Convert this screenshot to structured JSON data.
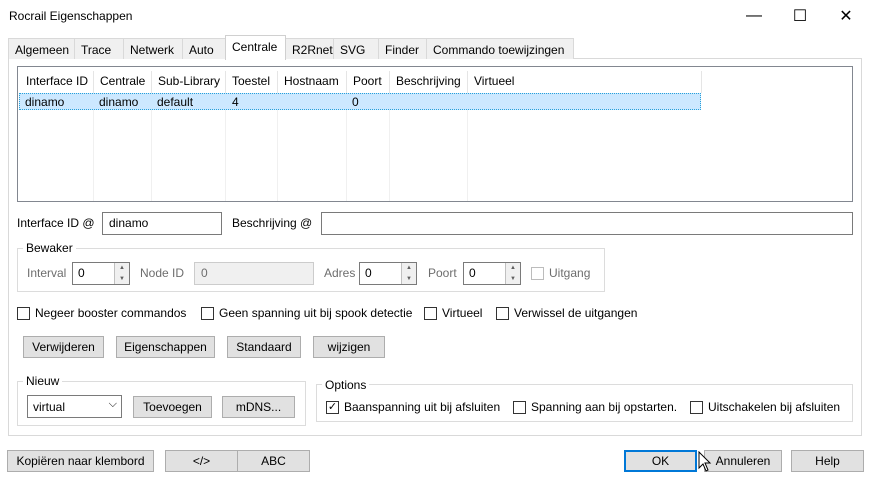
{
  "window": {
    "title": "Rocrail Eigenschappen",
    "minimize_glyph": "—",
    "maximize_glyph": "☐",
    "close_glyph": "✕"
  },
  "tabs": [
    {
      "label": "Algemeen"
    },
    {
      "label": "Trace"
    },
    {
      "label": "Netwerk"
    },
    {
      "label": "Auto"
    },
    {
      "label": "Centrale"
    },
    {
      "label": "R2Rnet"
    },
    {
      "label": "SVG"
    },
    {
      "label": "Finder"
    },
    {
      "label": "Commando toewijzingen"
    }
  ],
  "active_tab": "Centrale",
  "table": {
    "columns": [
      "Interface ID",
      "Centrale",
      "Sub-Library",
      "Toestel",
      "Hostnaam",
      "Poort",
      "Beschrijving",
      "Virtueel"
    ],
    "rows": [
      [
        "dinamo",
        "dinamo",
        "default",
        "4",
        "",
        "0",
        "",
        ""
      ]
    ]
  },
  "form": {
    "interface_id_label": "Interface ID @",
    "interface_id_value": "dinamo",
    "beschrijving_label": "Beschrijving @",
    "beschrijving_value": ""
  },
  "bewaker": {
    "title": "Bewaker",
    "interval_label": "Interval",
    "interval_value": "0",
    "nodeid_label": "Node ID",
    "nodeid_value": "0",
    "adres_label": "Adres",
    "adres_value": "0",
    "poort_label": "Poort",
    "poort_value": "0",
    "uitgang_label": "Uitgang",
    "uitgang_checked": false
  },
  "options_row": [
    {
      "label": "Negeer booster commandos",
      "checked": false
    },
    {
      "label": "Geen spanning uit bij spook detectie",
      "checked": false
    },
    {
      "label": "Virtueel",
      "checked": false
    },
    {
      "label": "Verwissel de uitgangen",
      "checked": false
    }
  ],
  "action_buttons": {
    "delete": "Verwijderen",
    "properties": "Eigenschappen",
    "default": "Standaard",
    "modify": "wijzigen"
  },
  "nieuw": {
    "title": "Nieuw",
    "selected": "virtual",
    "add_button": "Toevoegen",
    "mdns_button": "mDNS..."
  },
  "options": {
    "title": "Options",
    "items": [
      {
        "label": "Baanspanning uit bij afsluiten",
        "checked": true
      },
      {
        "label": "Spanning aan bij opstarten.",
        "checked": false
      },
      {
        "label": "Uitschakelen bij afsluiten",
        "checked": false
      }
    ]
  },
  "footer": {
    "copy": "Kopiëren naar klembord",
    "xml": "</>",
    "abc": "ABC",
    "ok": "OK",
    "cancel": "Annuleren",
    "help": "Help"
  },
  "colors": {
    "selection": "#cce8ff",
    "default_button_border": "#0078d7"
  }
}
